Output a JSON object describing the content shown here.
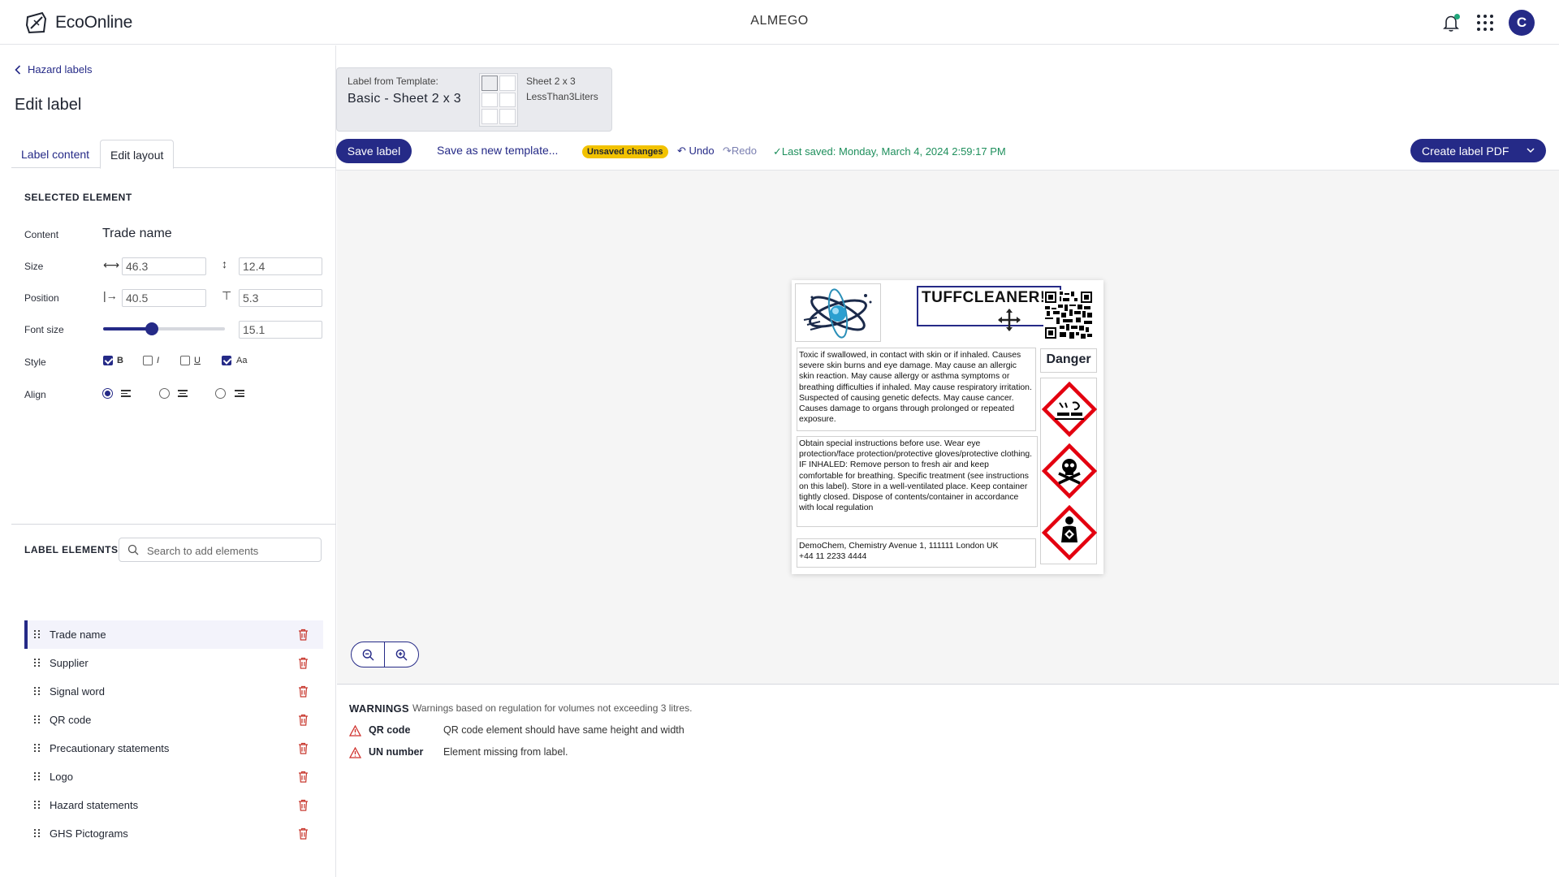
{
  "app": {
    "logo_text": "EcoOnline",
    "org_name": "ALMEGO",
    "avatar_initial": "C",
    "accent_color": "#252a87"
  },
  "nav": {
    "back_label": "Hazard labels",
    "page_title": "Edit label",
    "tabs": [
      {
        "label": "Label content"
      },
      {
        "label": "Edit layout"
      }
    ]
  },
  "selected_element": {
    "heading": "SELECTED ELEMENT",
    "content_label": "Content",
    "content_value": "Trade name",
    "size_label": "Size",
    "size_width": "46.3",
    "size_height": "12.4",
    "position_label": "Position",
    "position_x": "40.5",
    "position_y": "5.3",
    "font_size_label": "Font size",
    "font_size_value": "15.1",
    "font_size_slider_fraction": 0.4,
    "style_label": "Style",
    "style_options": [
      {
        "label": "B",
        "checked": true
      },
      {
        "label": "I",
        "checked": false
      },
      {
        "label": "U",
        "checked": false
      },
      {
        "label": "Aa",
        "checked": true
      }
    ],
    "align_label": "Align",
    "align_selected": "left"
  },
  "label_elements": {
    "heading": "LABEL ELEMENTS",
    "search_placeholder": "Search to add elements",
    "items": [
      {
        "label": "Trade name"
      },
      {
        "label": "Supplier"
      },
      {
        "label": "Signal word"
      },
      {
        "label": "QR code"
      },
      {
        "label": "Precautionary statements"
      },
      {
        "label": "Logo"
      },
      {
        "label": "Hazard statements"
      },
      {
        "label": "GHS Pictograms"
      }
    ]
  },
  "template": {
    "from_label": "Label from Template:",
    "name": "Basic - Sheet 2 x 3",
    "sheet": "Sheet 2 x 3",
    "size_class": "LessThan3Liters"
  },
  "toolbar": {
    "save_label": "Save label",
    "save_template_label": "Save as new template...",
    "unsaved_badge": "Unsaved changes",
    "undo_label": "Undo",
    "redo_label": "Redo",
    "last_saved": "Last saved: Monday, March 4, 2024 2:59:17 PM",
    "create_pdf_label": "Create label PDF"
  },
  "label_preview": {
    "trade_name": "TUFFCLEANER!!",
    "signal_word": "Danger",
    "hazard_statements": "Toxic if swallowed, in contact with skin or if inhaled. Causes severe skin burns and eye damage. May cause an allergic skin reaction. May cause allergy or asthma symptoms or breathing difficulties if inhaled. May cause respiratory irritation. Suspected of causing genetic defects. May cause cancer. Causes damage to organs through prolonged or repeated exposure.",
    "precautionary_statements": "Obtain special instructions before use. Wear eye protection/face protection/protective gloves/protective clothing. IF INHALED: Remove person to fresh air and keep comfortable for breathing. Specific treatment (see instructions on this label). Store in a well-ventilated place. Keep container tightly closed. Dispose of contents/container in accordance with local regulation",
    "supplier_line1": "DemoChem, Chemistry Avenue 1, 111111 London UK",
    "supplier_line2": "+44 11 2233 4444",
    "pictograms": [
      "corrosion-icon",
      "skull-crossbones-icon",
      "health-hazard-icon"
    ],
    "pictogram_color": "#e3000f"
  },
  "warnings": {
    "heading": "WARNINGS",
    "subtitle": "Warnings based on regulation for volumes not exceeding 3 litres.",
    "items": [
      {
        "title": "QR code",
        "message": "QR code element should have same height and width"
      },
      {
        "title": "UN number",
        "message": "Element missing from label."
      }
    ],
    "warning_color": "#d0312d"
  }
}
